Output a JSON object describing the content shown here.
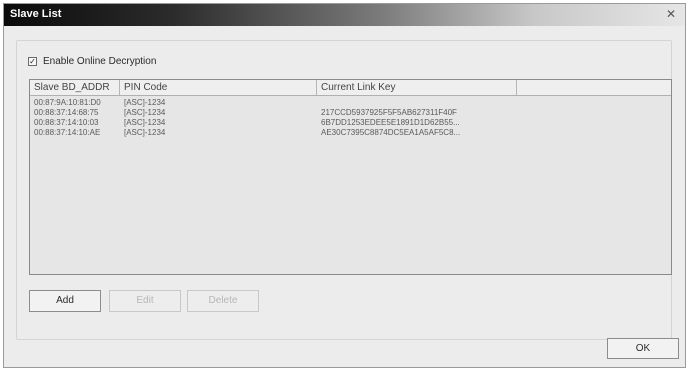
{
  "window": {
    "title": "Slave List",
    "close_icon": "close-icon"
  },
  "options": {
    "enable_label": "Enable Online Decryption",
    "enable_checked": true
  },
  "list": {
    "columns": [
      "Slave BD_ADDR",
      "PIN Code",
      "Current Link Key"
    ],
    "rows": [
      {
        "addr": "00:87:9A:10:81:D0",
        "pin": "[ASC]-1234",
        "key": ""
      },
      {
        "addr": "00:88:37:14:68:75",
        "pin": "[ASC]-1234",
        "key": "217CCD5937925F5F5AB627311F40F"
      },
      {
        "addr": "00:88:37:14:10:03",
        "pin": "[ASC]-1234",
        "key": "6B7DD1253EDEE5E1891D1D62B55..."
      },
      {
        "addr": "00:88:37:14:10:AE",
        "pin": "[ASC]-1234",
        "key": "AE30C7395C8874DC5EA1A5AF5C8..."
      }
    ]
  },
  "buttons": {
    "add": "Add",
    "edit": "Edit",
    "delete": "Delete",
    "ok": "OK"
  }
}
